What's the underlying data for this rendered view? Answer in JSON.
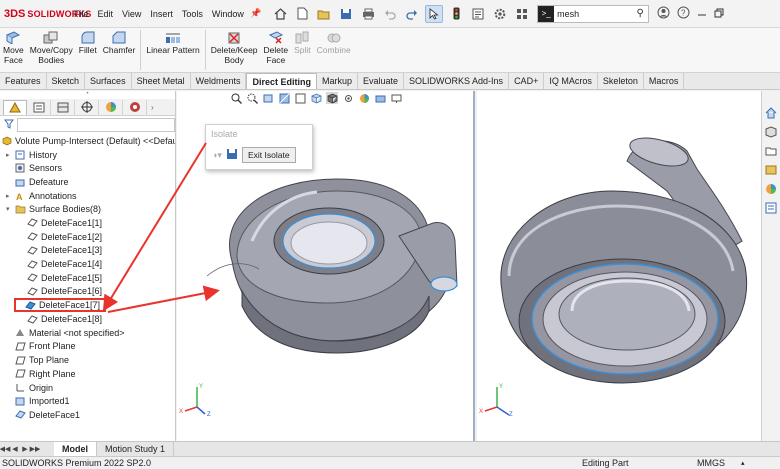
{
  "app": {
    "logo_mark": "3DS",
    "logo_text": "SOLIDWORKS"
  },
  "menu": [
    "File",
    "Edit",
    "View",
    "Insert",
    "Tools",
    "Window"
  ],
  "search": {
    "prompt_icon": ">_",
    "value": "mesh"
  },
  "commands": [
    {
      "label": "Move\nFace"
    },
    {
      "label": "Move/Copy\nBodies"
    },
    {
      "label": "Fillet"
    },
    {
      "label": "Chamfer"
    },
    {
      "label": "Linear Pattern"
    },
    {
      "label": "Delete/Keep\nBody"
    },
    {
      "label": "Delete\nFace"
    },
    {
      "label": "Split"
    },
    {
      "label": "Combine"
    }
  ],
  "tabs": [
    "Features",
    "Sketch",
    "Surfaces",
    "Sheet Metal",
    "Weldments",
    "Direct Editing",
    "Markup",
    "Evaluate",
    "SOLIDWORKS Add-Ins",
    "CAD+",
    "IQ MAcros",
    "Skeleton",
    "Macros"
  ],
  "active_tab": "Direct Editing",
  "tree": {
    "root": "Volute Pump-Intersect (Default) <<Defaul",
    "items": [
      {
        "label": "History"
      },
      {
        "label": "Sensors"
      },
      {
        "label": "Defeature"
      },
      {
        "label": "Annotations"
      },
      {
        "label": "Surface Bodies(8)"
      },
      {
        "label": "DeleteFace1[1]"
      },
      {
        "label": "DeleteFace1[2]"
      },
      {
        "label": "DeleteFace1[3]"
      },
      {
        "label": "DeleteFace1[4]"
      },
      {
        "label": "DeleteFace1[5]"
      },
      {
        "label": "DeleteFace1[6]"
      },
      {
        "label": "DeleteFace1[7]"
      },
      {
        "label": "DeleteFace1[8]"
      },
      {
        "label": "Material <not specified>"
      },
      {
        "label": "Front Plane"
      },
      {
        "label": "Top Plane"
      },
      {
        "label": "Right Plane"
      },
      {
        "label": "Origin"
      },
      {
        "label": "Imported1"
      },
      {
        "label": "DeleteFace1"
      }
    ]
  },
  "isolate": {
    "title": "Isolate",
    "exit_label": "Exit Isolate"
  },
  "triad": {
    "x": "X",
    "y": "Y",
    "z": "Z"
  },
  "bottom_tabs": [
    "Model",
    "Motion Study 1"
  ],
  "status": {
    "product": "SOLIDWORKS Premium 2022 SP2.0",
    "mode": "Editing Part",
    "units": "MMGS"
  },
  "colors": {
    "accent_red": "#e8342c",
    "body_gray": "#8e909c",
    "edge_blue": "#3a8fd8"
  }
}
